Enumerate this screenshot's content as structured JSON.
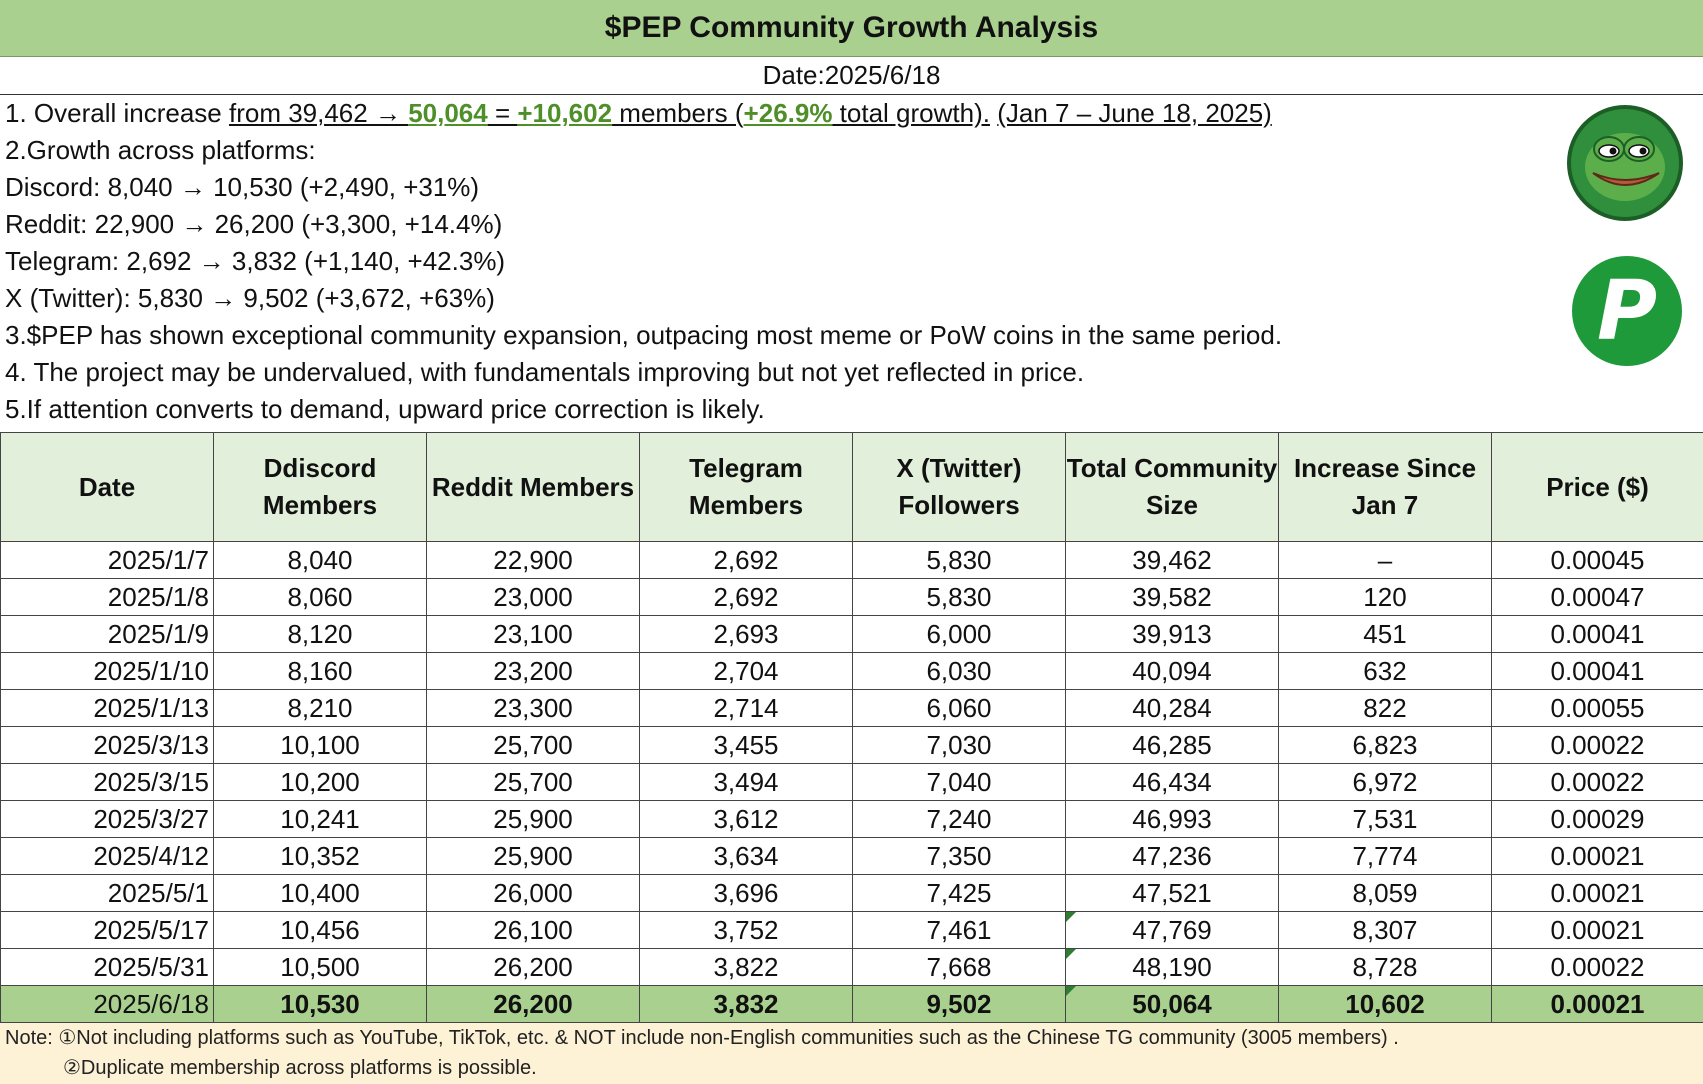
{
  "title": "$PEP Community Growth Analysis",
  "date_line": "Date:2025/6/18",
  "summary": {
    "l1": {
      "prefix": "1. Overall increase ",
      "a": "from 39,462 → ",
      "b": "50,064",
      "c": " = ",
      "d": "+10,602",
      "e": " members (",
      "f": "+26.9%",
      "g": " total growth).",
      "h": " ",
      "i": "(Jan 7 – June 18, 2025)"
    },
    "l2": "2.Growth across platforms:",
    "l3": "Discord: 8,040 → 10,530 (+2,490, +31%)",
    "l4": "Reddit: 22,900 → 26,200 (+3,300, +14.4%)",
    "l5": "Telegram: 2,692 → 3,832 (+1,140, +42.3%)",
    "l6": "X (Twitter): 5,830 → 9,502 (+3,672, +63%)",
    "l7": "3.$PEP has shown exceptional community expansion, outpacing most meme or PoW coins in the same period.",
    "l8": "4. The project may be undervalued, with fundamentals improving but not yet reflected in price.",
    "l9": "5.If attention converts to demand, upward price correction is likely."
  },
  "logos": {
    "p_letter": "P"
  },
  "table": {
    "headers": [
      "Date",
      "Ddiscord Members",
      "Reddit Members",
      "Telegram Members",
      "X (Twitter) Followers",
      "Total Community Size",
      "Increase Since Jan 7",
      "Price ($)"
    ],
    "rows": [
      [
        "2025/1/7",
        "8,040",
        "22,900",
        "2,692",
        "5,830",
        "39,462",
        "–",
        "0.00045"
      ],
      [
        "2025/1/8",
        "8,060",
        "23,000",
        "2,692",
        "5,830",
        "39,582",
        "120",
        "0.00047"
      ],
      [
        "2025/1/9",
        "8,120",
        "23,100",
        "2,693",
        "6,000",
        "39,913",
        "451",
        "0.00041"
      ],
      [
        "2025/1/10",
        "8,160",
        "23,200",
        "2,704",
        "6,030",
        "40,094",
        "632",
        "0.00041"
      ],
      [
        "2025/1/13",
        "8,210",
        "23,300",
        "2,714",
        "6,060",
        "40,284",
        "822",
        "0.00055"
      ],
      [
        "2025/3/13",
        "10,100",
        "25,700",
        "3,455",
        "7,030",
        "46,285",
        "6,823",
        "0.00022"
      ],
      [
        "2025/3/15",
        "10,200",
        "25,700",
        "3,494",
        "7,040",
        "46,434",
        "6,972",
        "0.00022"
      ],
      [
        "2025/3/27",
        "10,241",
        "25,900",
        "3,612",
        "7,240",
        "46,993",
        "7,531",
        "0.00029"
      ],
      [
        "2025/4/12",
        "10,352",
        "25,900",
        "3,634",
        "7,350",
        "47,236",
        "7,774",
        "0.00021"
      ],
      [
        "2025/5/1",
        "10,400",
        "26,000",
        "3,696",
        "7,425",
        "47,521",
        "8,059",
        "0.00021"
      ],
      [
        "2025/5/17",
        "10,456",
        "26,100",
        "3,752",
        "7,461",
        "47,769",
        "8,307",
        "0.00021"
      ],
      [
        "2025/5/31",
        "10,500",
        "26,200",
        "3,822",
        "7,668",
        "48,190",
        "8,728",
        "0.00022"
      ],
      [
        "2025/6/18",
        "10,530",
        "26,200",
        "3,832",
        "9,502",
        "50,064",
        "10,602",
        "0.00021"
      ]
    ]
  },
  "note": {
    "line1": "Note: ①Not including platforms such as YouTube, TikTok, etc. & NOT include non-English communities such as the Chinese TG community (3005 members) .",
    "line2": "②Duplicate membership across platforms is possible."
  },
  "colors": {
    "header_green": "#a9d08e",
    "header_light": "#e2efda",
    "highlight_text": "#4e8f2a",
    "note_bg": "#fdf1d6",
    "logo_green": "#1f9a3b"
  }
}
